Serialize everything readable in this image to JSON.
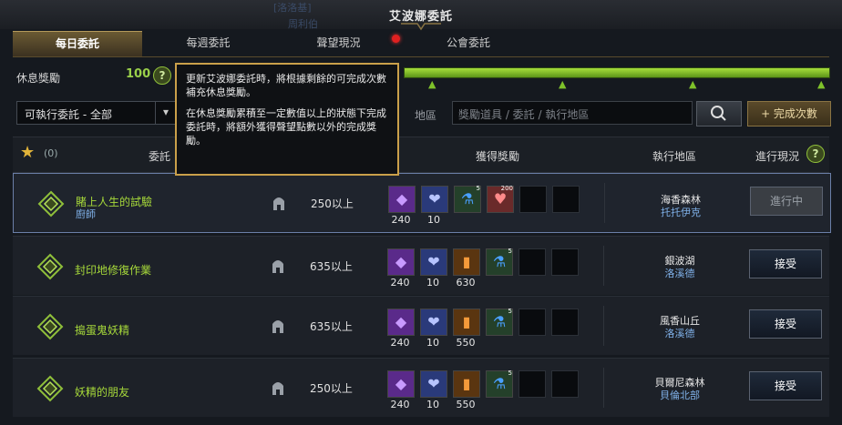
{
  "window": {
    "title": "艾波娜委託",
    "bg_name": "[洛洛基]",
    "bg_name2": "周利伯",
    "bg_mid1": "受阿爾斯...",
    "bg_mid2": "..."
  },
  "tabs": [
    {
      "label": "每日委託",
      "active": true
    },
    {
      "label": "每週委託",
      "active": false
    },
    {
      "label": "聲望現況",
      "active": false,
      "notification": true
    },
    {
      "label": "公會委託",
      "active": false
    }
  ],
  "rest": {
    "label": "休息獎勵",
    "value": "100",
    "help": "?"
  },
  "tooltip": {
    "p1": "更新艾波娜委託時，將根據剩餘的可完成次數補充休息獎勵。",
    "p2": "在休息獎勵累積至一定數值以上的狀態下完成委託時，將額外獲得聲望點數以外的完成獎勵。"
  },
  "filter": {
    "select_value": "可執行委託 - 全部",
    "location_label": "地區",
    "search_placeholder": "獎勵道具 / 委託 / 執行地區",
    "complete_button": "+ 完成次數"
  },
  "table": {
    "favorite_count": "(0)",
    "headers": {
      "quest": "委託",
      "reward": "獲得獎勵",
      "location": "執行地區",
      "status": "進行現況"
    }
  },
  "rows": [
    {
      "name": "賭上人生的試驗",
      "sub": "廚師",
      "req": "250以上",
      "rewards": [
        {
          "type": "purple",
          "count": "240"
        },
        {
          "type": "heart",
          "count": "10"
        },
        {
          "type": "potion",
          "count": "",
          "sup": "5"
        },
        {
          "type": "pink",
          "count": "",
          "sup": "200"
        }
      ],
      "loc1": "海香森林",
      "loc2": "托托伊克",
      "button": "進行中",
      "button_type": "prog",
      "selected": true
    },
    {
      "name": "封印地修復作業",
      "sub": "",
      "req": "635以上",
      "rewards": [
        {
          "type": "purple",
          "count": "240"
        },
        {
          "type": "heart",
          "count": "10"
        },
        {
          "type": "orange",
          "count": "630"
        },
        {
          "type": "potion",
          "count": "",
          "sup": "5"
        }
      ],
      "loc1": "銀波湖",
      "loc2": "洛溪德",
      "button": "接受",
      "button_type": "accept",
      "selected": false
    },
    {
      "name": "搗蛋鬼妖精",
      "sub": "",
      "req": "635以上",
      "rewards": [
        {
          "type": "purple",
          "count": "240"
        },
        {
          "type": "heart",
          "count": "10"
        },
        {
          "type": "orange",
          "count": "550"
        },
        {
          "type": "potion",
          "count": "",
          "sup": "5"
        }
      ],
      "loc1": "風香山丘",
      "loc2": "洛溪德",
      "button": "接受",
      "button_type": "accept",
      "selected": false
    },
    {
      "name": "妖精的朋友",
      "sub": "",
      "req": "250以上",
      "rewards": [
        {
          "type": "purple",
          "count": "240"
        },
        {
          "type": "heart",
          "count": "10"
        },
        {
          "type": "orange",
          "count": "550"
        },
        {
          "type": "potion",
          "count": "",
          "sup": "5"
        }
      ],
      "loc1": "貝爾尼森林",
      "loc2": "貝倫北部",
      "button": "接受",
      "button_type": "accept",
      "selected": false
    }
  ],
  "colors": {
    "accent_green": "#9ad04a",
    "tooltip_border": "#caa04a",
    "link_blue": "#7fb0e8"
  }
}
